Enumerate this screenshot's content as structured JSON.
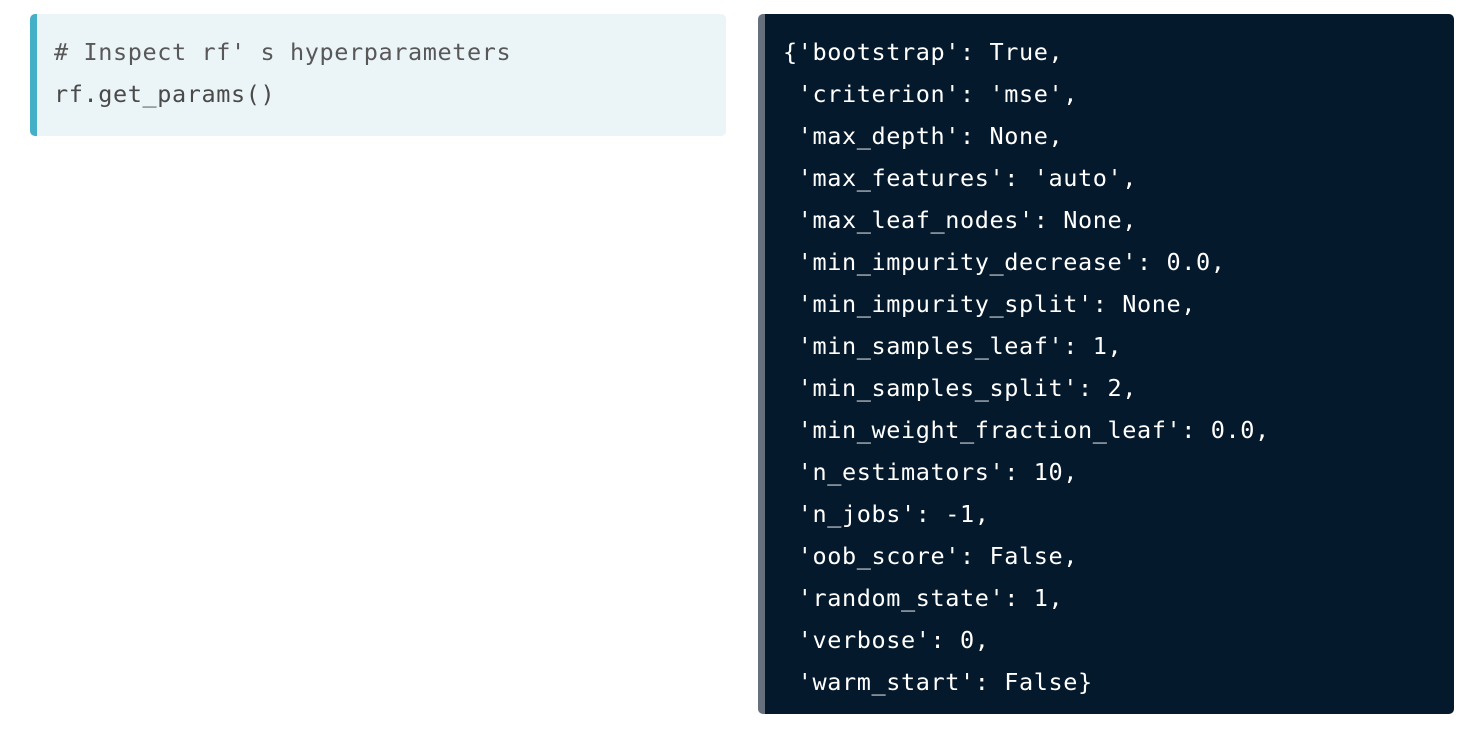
{
  "input_cell": {
    "lines": [
      "# Inspect rf' s hyperparameters",
      "rf.get_params()"
    ]
  },
  "output_cell": {
    "lines": [
      "{'bootstrap': True,",
      " 'criterion': 'mse',",
      " 'max_depth': None,",
      " 'max_features': 'auto',",
      " 'max_leaf_nodes': None,",
      " 'min_impurity_decrease': 0.0,",
      " 'min_impurity_split': None,",
      " 'min_samples_leaf': 1,",
      " 'min_samples_split': 2,",
      " 'min_weight_fraction_leaf': 0.0,",
      " 'n_estimators': 10,",
      " 'n_jobs': -1,",
      " 'oob_score': False,",
      " 'random_state': 1,",
      " 'verbose': 0,",
      " 'warm_start': False}"
    ]
  },
  "colors": {
    "input_background": "#ebf4f7",
    "input_accent": "#43b0c8",
    "output_background": "#05192d",
    "output_accent": "#65707c"
  }
}
